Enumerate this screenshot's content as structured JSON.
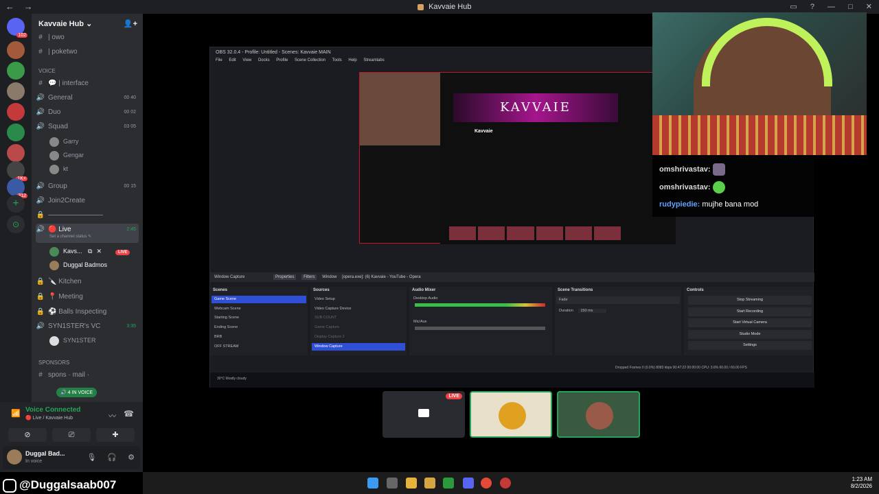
{
  "window": {
    "title": "Kavvaie Hub",
    "nav_back": "←",
    "nav_fwd": "→"
  },
  "servers": {
    "badges": [
      "102",
      "1K+",
      "312"
    ]
  },
  "guild": {
    "name": "Kavvaie Hub",
    "chevron": "⌄"
  },
  "channels": {
    "top": [
      {
        "icon": "#",
        "label": "| owo"
      },
      {
        "icon": "#",
        "label": "| poketwo"
      }
    ],
    "voice_category": "VOICE",
    "voice": [
      {
        "icon": "#",
        "label": "💬 | interface"
      },
      {
        "icon": "🔊",
        "label": "General",
        "count": "00 40"
      },
      {
        "icon": "🔊",
        "label": "Duo",
        "count": "00 02"
      },
      {
        "icon": "🔊",
        "label": "Squad",
        "count": "03 05"
      }
    ],
    "squad_users": [
      "Garry",
      "Gengar",
      "kt"
    ],
    "voice2": [
      {
        "icon": "🔊",
        "label": "Group",
        "count": "00 15"
      },
      {
        "icon": "🔊",
        "label": "Join2Create"
      },
      {
        "icon": "🔒",
        "label": "————————"
      },
      {
        "icon": "🔊",
        "label": "🔴 Live",
        "count": "2:45"
      }
    ],
    "live_status": "Set a channel status ✎",
    "live_users": [
      {
        "name": "Kavs...",
        "badge": "LIVE"
      },
      {
        "name": "Duggal Badmos"
      }
    ],
    "voice3": [
      {
        "icon": "🔒",
        "label": "🔪 Kitchen"
      },
      {
        "icon": "🔒",
        "label": "📍 Meeting"
      },
      {
        "icon": "🔒",
        "label": "⚽ Balls Inspecting"
      },
      {
        "icon": "🔊",
        "label": "SYN1STER's VC",
        "count": "3:35"
      }
    ],
    "syn_user": "SYN1STER",
    "sponsors_category": "SPONSORS",
    "sponsors": [
      {
        "icon": "#",
        "label": "spons · mail ·"
      }
    ],
    "in_voice": "🔊 4 IN VOICE"
  },
  "voice_panel": {
    "status": "Voice Connected",
    "sub": "🔴 Live / Kavvaie Hub",
    "username": "Duggal Bad...",
    "user_sub": "In voice"
  },
  "obs": {
    "title": "OBS 32.0.4 - Profile: Untitled - Scenes: Kavvaie MAIN",
    "menu": [
      "File",
      "Edit",
      "View",
      "Docks",
      "Profile",
      "Scene Collection",
      "Tools",
      "Help",
      "Streamlabs"
    ],
    "preview_banner": "KAVVAIE",
    "preview_channel": "Kavvaie",
    "source_toolbar": {
      "source": "Window Capture",
      "properties": "Properties",
      "filters": "Filters",
      "window_label": "Window",
      "window_value": "[opera.exe]: (6) Kavvaie - YouTube - Opera"
    },
    "scenes_title": "Scenes",
    "scenes": [
      "Game Scene",
      "Webcam Scene",
      "Starting Scene",
      "Ending Scene",
      "BRB",
      "OFF STREAM"
    ],
    "sources_title": "Sources",
    "sources": [
      "Video Setup",
      "Video Capture Device",
      "SUB COUNT",
      "Game Capture",
      "Display Capture 2",
      "Window Capture"
    ],
    "mixer_title": "Audio Mixer",
    "mixer": [
      "Desktop Audio",
      "Mic/Aux"
    ],
    "transitions_title": "Scene Transitions",
    "transition": "Fade",
    "duration_label": "Duration",
    "duration": "150 ms",
    "controls_title": "Controls",
    "controls": [
      "Stop Streaming",
      "Start Recording",
      "Start Virtual Camera",
      "Studio Mode",
      "Settings"
    ],
    "status": "Dropped Frames 0 (0.0%)   8083 kbps   00:47:22   00:00:00   CPU: 3.6%   60.00 / 60.00 FPS",
    "weather": "30°C Mostly cloudy"
  },
  "chat": [
    {
      "user": "omshrivastav:",
      "text": ""
    },
    {
      "user": "omshrivastav:",
      "text": ""
    },
    {
      "user": "rudypiedie:",
      "text": "mujhe bana mod"
    }
  ],
  "tiles": {
    "live": "LIVE"
  },
  "handle": "@Duggalsaab007",
  "taskbar": {
    "time": "1:23 AM",
    "date": "8/2/2026"
  }
}
